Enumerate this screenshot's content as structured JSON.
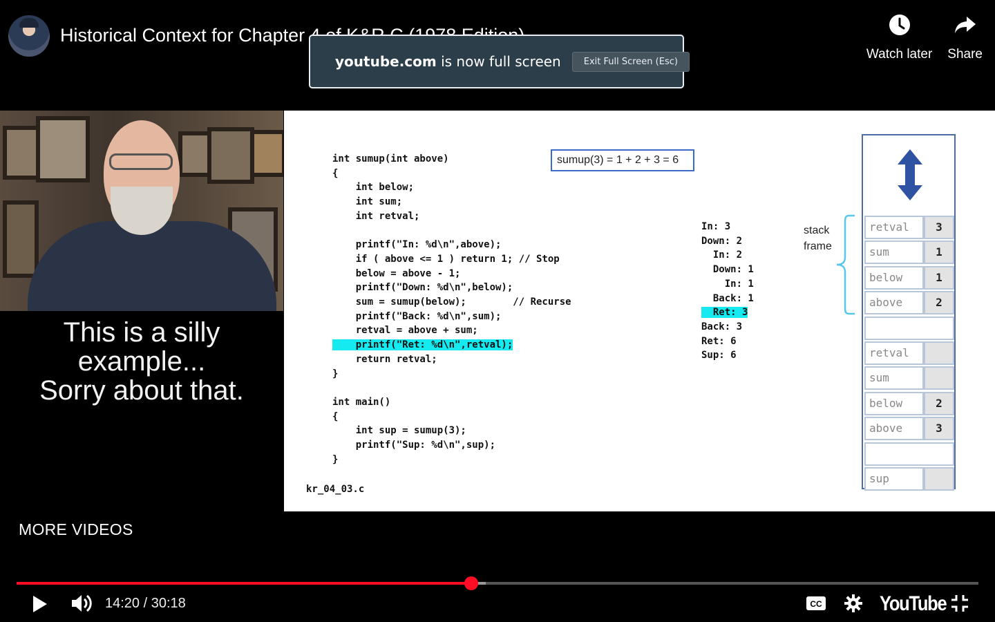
{
  "video": {
    "title": "Historical Context for Chapter 4 of K&R C (1978 Edition)"
  },
  "top_actions": {
    "watch_later": "Watch later",
    "share": "Share"
  },
  "fullscreen_notice": {
    "domain": "youtube.com",
    "message": "is now full screen",
    "exit_label": "Exit Full Screen (Esc)"
  },
  "presenter": {
    "caption_lines": [
      "This is a silly",
      "example...",
      "Sorry about that."
    ]
  },
  "slide": {
    "code_lines": [
      "int sumup(int above)",
      "{",
      "    int below;",
      "    int sum;",
      "    int retval;",
      "",
      "    printf(\"In: %d\\n\",above);",
      "    if ( above <= 1 ) return 1; // Stop",
      "    below = above - 1;",
      "    printf(\"Down: %d\\n\",below);",
      "    sum = sumup(below);        // Recurse",
      "    printf(\"Back: %d\\n\",sum);",
      "    retval = above + sum;",
      "    printf(\"Ret: %d\\n\",retval);",
      "    return retval;",
      "}",
      "",
      "int main()",
      "{",
      "    int sup = sumup(3);",
      "    printf(\"Sup: %d\\n\",sup);",
      "}"
    ],
    "highlight_code_line": 13,
    "sum_box": "sumup(3) = 1 + 2 + 3 = 6",
    "trace_lines": [
      "In: 3",
      "Down: 2",
      "  In: 2",
      "  Down: 1",
      "    In: 1",
      "  Back: 1",
      "  Ret: 3",
      "Back: 3",
      "Ret: 6",
      "Sup: 6"
    ],
    "highlight_trace_line": 6,
    "filename": "kr_04_03.c",
    "stack_label": [
      "stack",
      "frame"
    ],
    "stack_rows": [
      {
        "name": "retval",
        "value": "3"
      },
      {
        "name": "sum",
        "value": "1"
      },
      {
        "name": "below",
        "value": "1"
      },
      {
        "name": "above",
        "value": "2"
      },
      {
        "blank": true
      },
      {
        "name": "retval",
        "value": ""
      },
      {
        "name": "sum",
        "value": ""
      },
      {
        "name": "below",
        "value": "2"
      },
      {
        "name": "above",
        "value": "3"
      },
      {
        "blank": true
      },
      {
        "name": "sup",
        "value": ""
      }
    ]
  },
  "more_videos": "MORE VIDEOS",
  "player": {
    "current_time": "14:20",
    "duration": "30:18",
    "time_display": "14:20 / 30:18",
    "progress_fraction": 0.473,
    "buffered_fraction": 0.488,
    "logo": "YouTube"
  },
  "colors": {
    "progress_red": "#ff0d24",
    "highlight_cyan": "#14eaf0",
    "notice_bg": "#2c3e4a"
  },
  "icons": {
    "watch_later": "clock-icon",
    "share": "share-arrow-icon",
    "lock": "lock-icon",
    "play": "play-icon",
    "volume": "volume-icon",
    "captions": "cc-icon",
    "settings": "gear-icon",
    "exit_fullscreen": "exit-fullscreen-icon"
  }
}
